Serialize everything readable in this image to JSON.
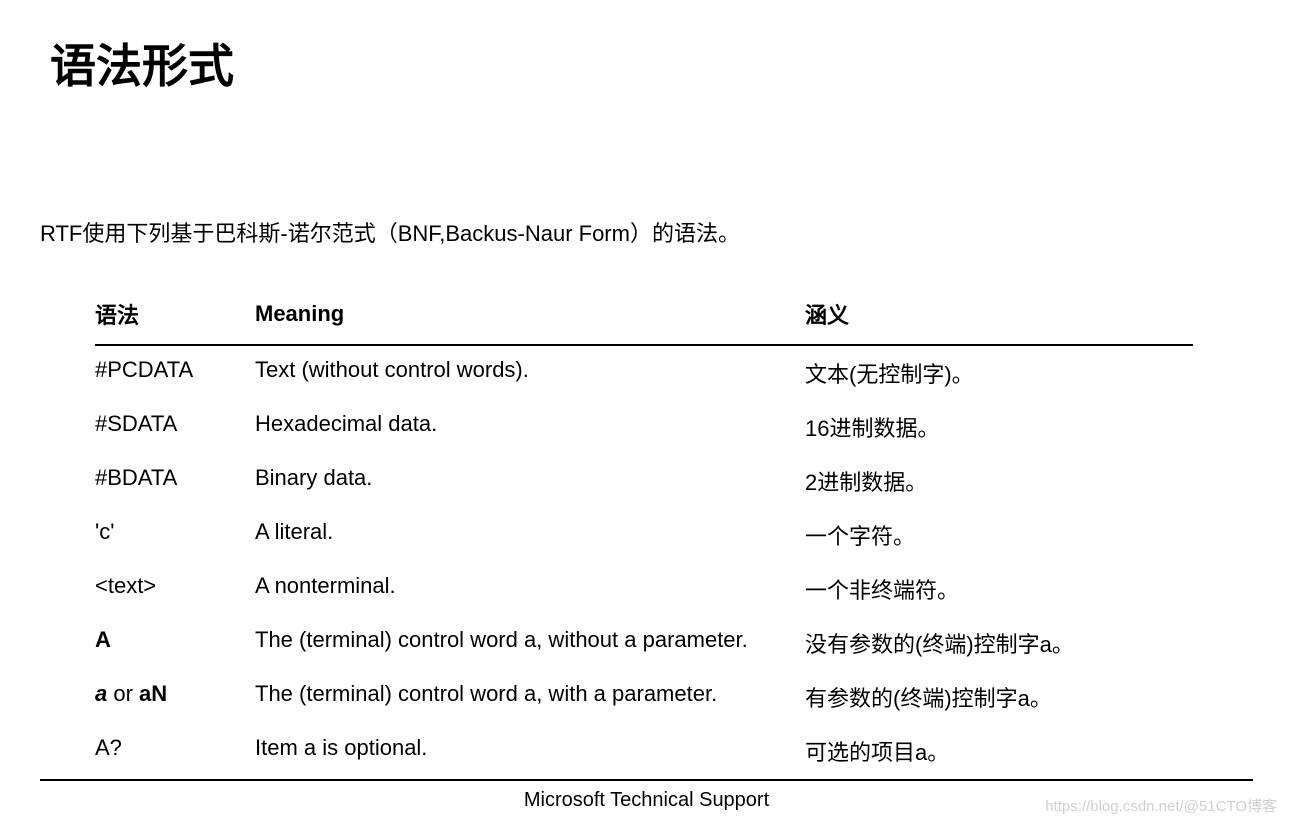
{
  "title": "语法形式",
  "intro": "RTF使用下列基于巴科斯-诺尔范式（BNF,Backus-Naur Form）的语法。",
  "table": {
    "headers": {
      "syntax": "语法",
      "meaning": "Meaning",
      "cn": "涵义"
    },
    "rows": [
      {
        "syntax": "#PCDATA",
        "meaning": "Text (without control words).",
        "cn": "文本(无控制字)。"
      },
      {
        "syntax": "#SDATA",
        "meaning": "Hexadecimal data.",
        "cn": "16进制数据。"
      },
      {
        "syntax": "#BDATA",
        "meaning": "Binary data.",
        "cn": "2进制数据。"
      },
      {
        "syntax": "'c'",
        "meaning": "A literal.",
        "cn": "一个字符。"
      },
      {
        "syntax": "<text>",
        "meaning": "A nonterminal.",
        "cn": "一个非终端符。"
      },
      {
        "syntax_html": "bold_A",
        "syntax": "A",
        "meaning": "The (terminal) control word a, without a parameter.",
        "cn": "没有参数的(终端)控制字a。"
      },
      {
        "syntax_html": "a_or_aN",
        "a": "a",
        "or": " or ",
        "aN": "aN",
        "meaning": "The (terminal) control word a, with a parameter.",
        "cn": "有参数的(终端)控制字a。"
      },
      {
        "syntax": "A?",
        "meaning": "Item a is optional.",
        "cn": "可选的项目a。"
      }
    ]
  },
  "footer": "Microsoft Technical Support",
  "watermark": "https://blog.csdn.net/@51CTO博客"
}
